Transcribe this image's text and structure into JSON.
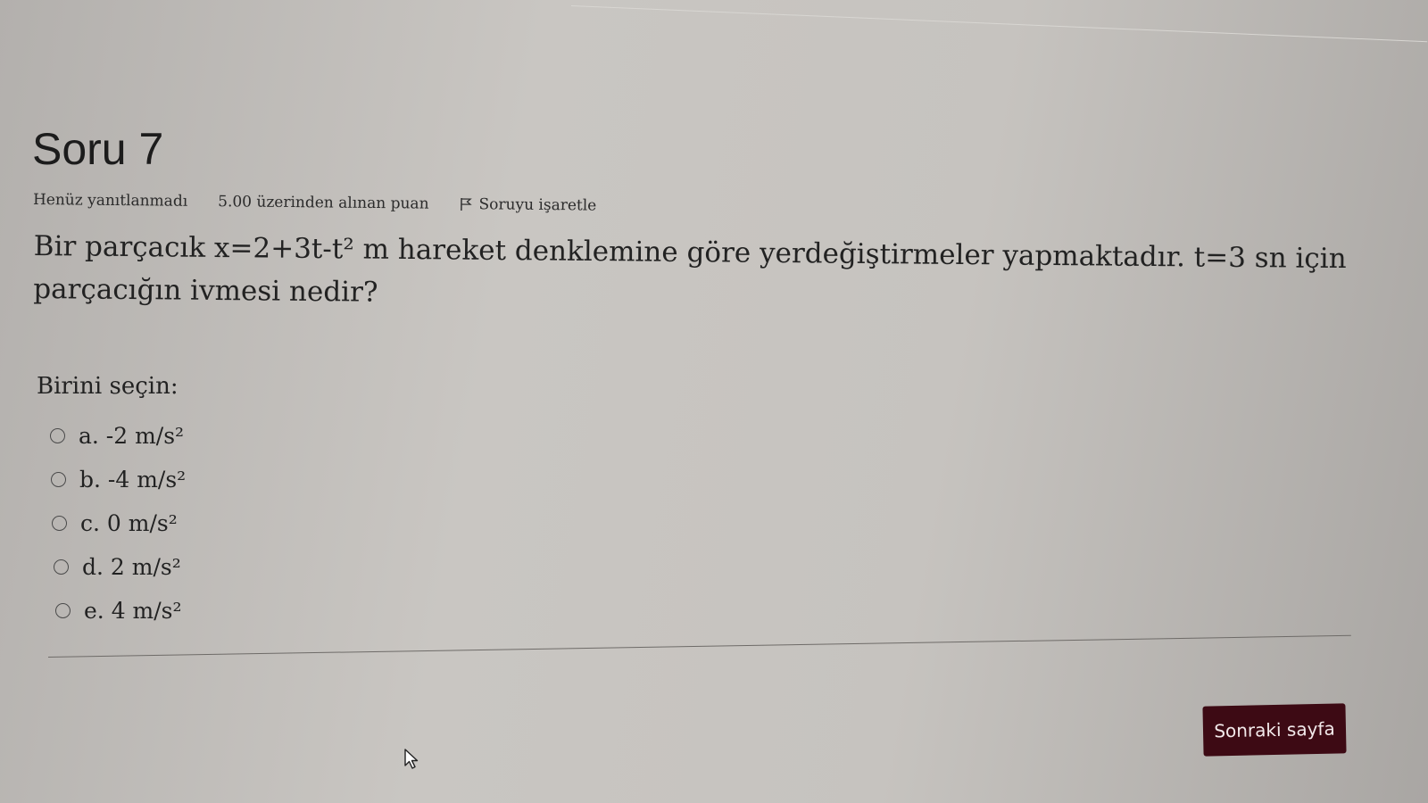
{
  "question": {
    "title": "Soru 7",
    "state": "Henüz yanıtlanmadı",
    "grade": "5.00 üzerinden alınan puan",
    "flag_label": "Soruyu işaretle",
    "text": "Bir parçacık x=2+3t-t² m hareket denklemine göre yerdeğiştirmeler yapmaktadır. t=3 sn için parçacığın ivmesi nedir?"
  },
  "answers": {
    "prompt": "Birini seçin:",
    "options": [
      {
        "label": "a. -2 m/s²",
        "selected": false
      },
      {
        "label": "b. -4 m/s²",
        "selected": false
      },
      {
        "label": "c. 0 m/s²",
        "selected": false
      },
      {
        "label": "d. 2 m/s²",
        "selected": false
      },
      {
        "label": "e. 4 m/s²",
        "selected": false
      }
    ]
  },
  "navigation": {
    "next_label": "Sonraki sayfa"
  },
  "colors": {
    "next_button_bg": "#3d0a14",
    "next_button_text": "#f2e9ea",
    "text": "#222222"
  },
  "icons": {
    "flag": "flag-icon",
    "cursor": "mouse-pointer-icon"
  }
}
